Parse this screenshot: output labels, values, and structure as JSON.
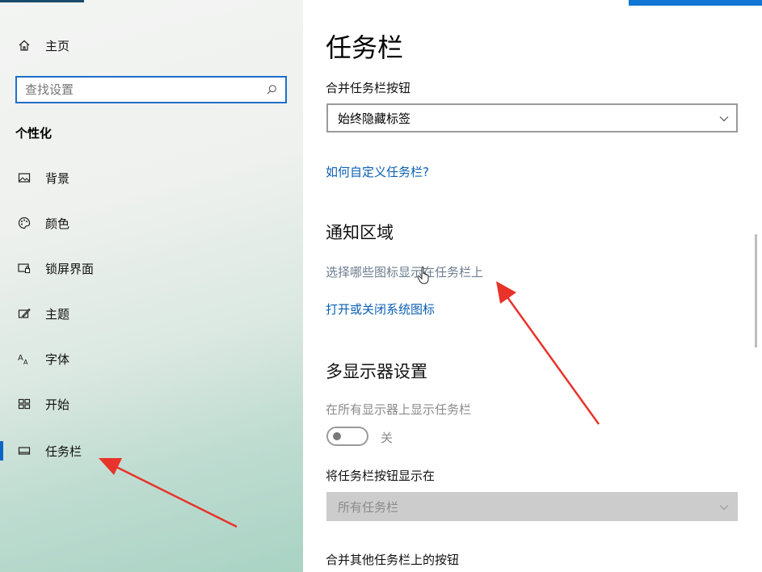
{
  "sidebar": {
    "home_label": "主页",
    "search_placeholder": "查找设置",
    "section_label": "个性化",
    "items": [
      {
        "label": "背景",
        "icon": "picture-icon"
      },
      {
        "label": "颜色",
        "icon": "palette-icon"
      },
      {
        "label": "锁屏界面",
        "icon": "lock-screen-icon"
      },
      {
        "label": "主题",
        "icon": "theme-icon"
      },
      {
        "label": "字体",
        "icon": "font-icon"
      },
      {
        "label": "开始",
        "icon": "start-icon"
      },
      {
        "label": "任务栏",
        "icon": "taskbar-icon",
        "selected": true
      }
    ]
  },
  "main": {
    "title": "任务栏",
    "combine_label": "合并任务栏按钮",
    "combine_value": "始终隐藏标签",
    "customize_link": "如何自定义任务栏?",
    "notification_heading": "通知区域",
    "select_icons_text": "选择哪些图标显示在任务栏上",
    "system_icons_link": "打开或关闭系统图标",
    "multi_display_heading": "多显示器设置",
    "show_all_label": "在所有显示器上显示任务栏",
    "toggle_state": "关",
    "show_buttons_on_label": "将任务栏按钮显示在",
    "show_buttons_on_value": "所有任务栏",
    "combine_other_label": "合并其他任务栏上的按钮"
  },
  "colors": {
    "accent": "#0a64c8",
    "link": "#0a5fb4",
    "annotation_arrow": "#e8332a"
  }
}
